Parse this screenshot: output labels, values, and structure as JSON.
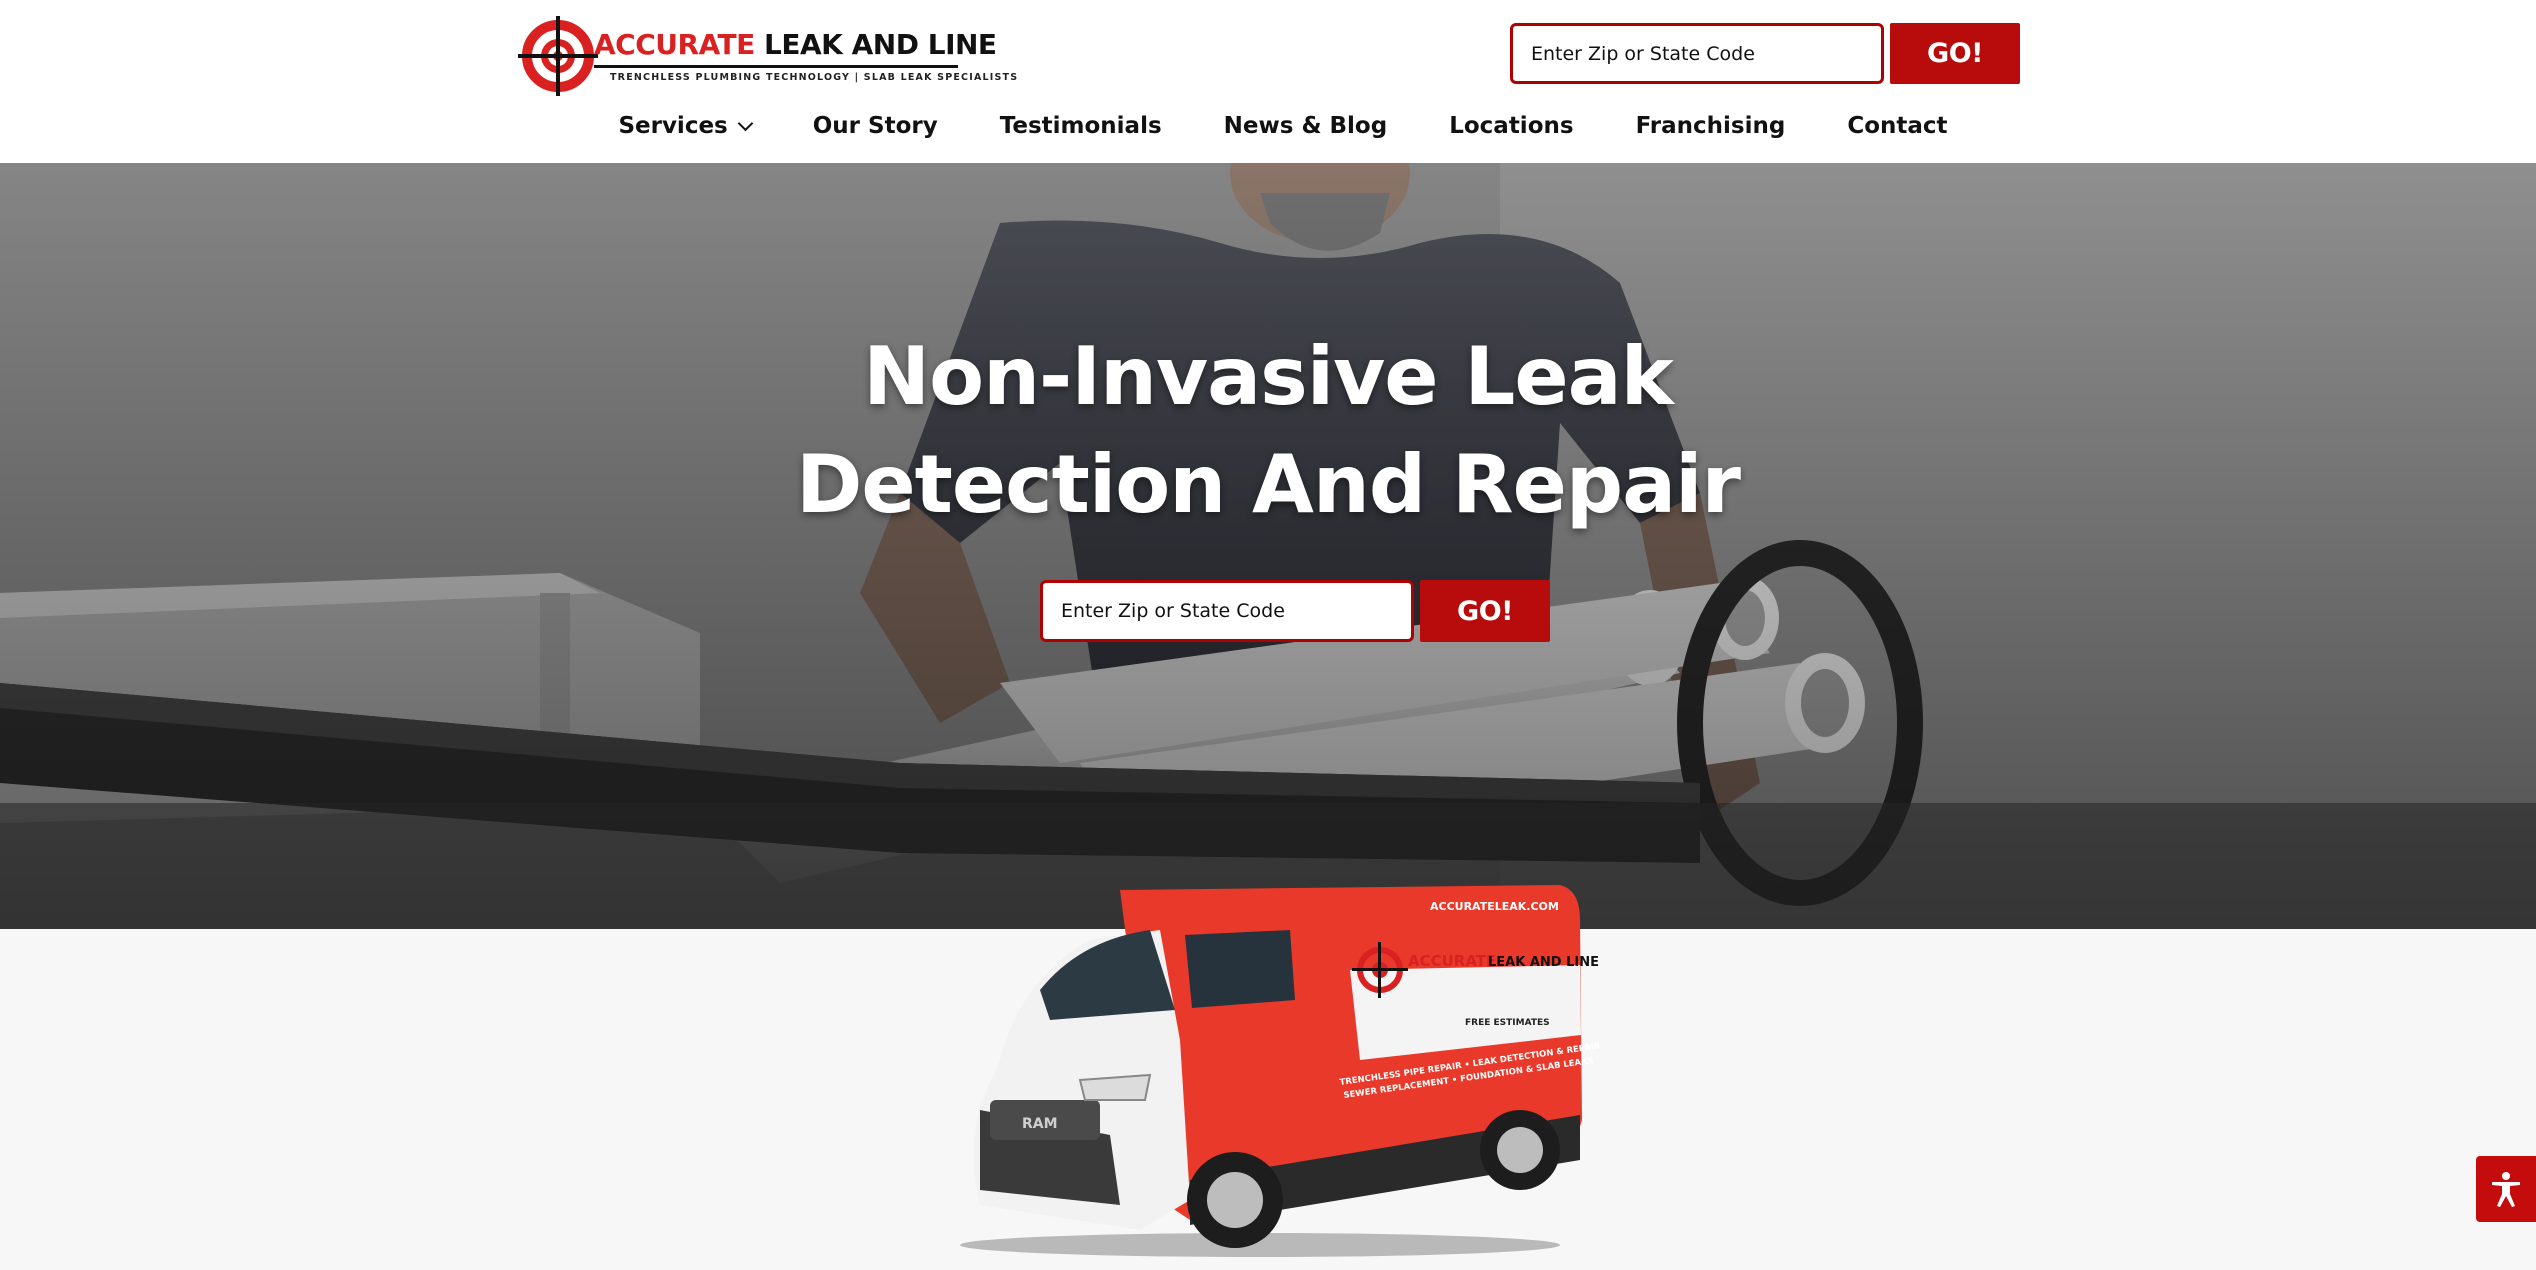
{
  "brand": {
    "name_red": "ACCURATE",
    "name_black": " LEAK AND LINE",
    "tagline": "TRENCHLESS PLUMBING TECHNOLOGY   |   SLAB LEAK SPECIALISTS",
    "primary_color": "#b80b0b"
  },
  "header_search": {
    "placeholder": "Enter Zip or State Code",
    "button_label": "GO!"
  },
  "nav": {
    "items": [
      {
        "label": "Services"
      },
      {
        "label": "Our Story"
      },
      {
        "label": "Testimonials"
      },
      {
        "label": "News & Blog"
      },
      {
        "label": "Locations"
      },
      {
        "label": "Franchising"
      },
      {
        "label": "Contact"
      }
    ]
  },
  "hero": {
    "title_line1": "Non-Invasive Leak",
    "title_line2": "Detection And Repair",
    "search_placeholder": "Enter Zip or State Code",
    "search_button": "GO!"
  },
  "van": {
    "website": "ACCURATELEAK.COM",
    "logo_red": "ACCURATE",
    "logo_black": "LEAK AND LINE",
    "free_estimates": "FREE ESTIMATES",
    "services_line": "TRENCHLESS PIPE REPAIR • LEAK DETECTION & REPAIR",
    "services_line2": "SEWER REPLACEMENT • FOUNDATION & SLAB LEAKS",
    "grille_brand": "RAM"
  },
  "accessibility": {
    "icon": "accessibility-icon"
  }
}
